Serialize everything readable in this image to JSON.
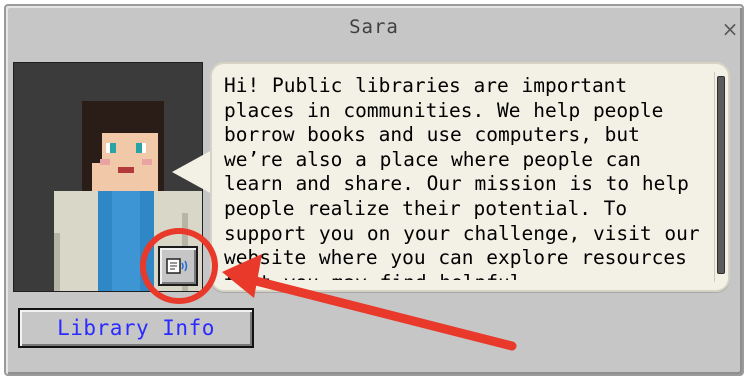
{
  "dialog": {
    "title": "Sara",
    "close_label": "×"
  },
  "speech": {
    "text": "Hi! Public libraries are important places in communities. We help people borrow books and use computers, but we’re also a place where people can learn and share. Our mission is to help people realize their potential.  To support you on your challenge, visit our website where you can explore resources that you may find helpful."
  },
  "buttons": {
    "library_info": "Library Info"
  },
  "colors": {
    "dialog_bg": "#c6c6c6",
    "bubble_bg": "#f3f1e5",
    "link_text": "#2b2bff",
    "annotation": "#e8392b"
  },
  "icons": {
    "tts": "text-to-speech-icon",
    "close": "close-icon"
  }
}
